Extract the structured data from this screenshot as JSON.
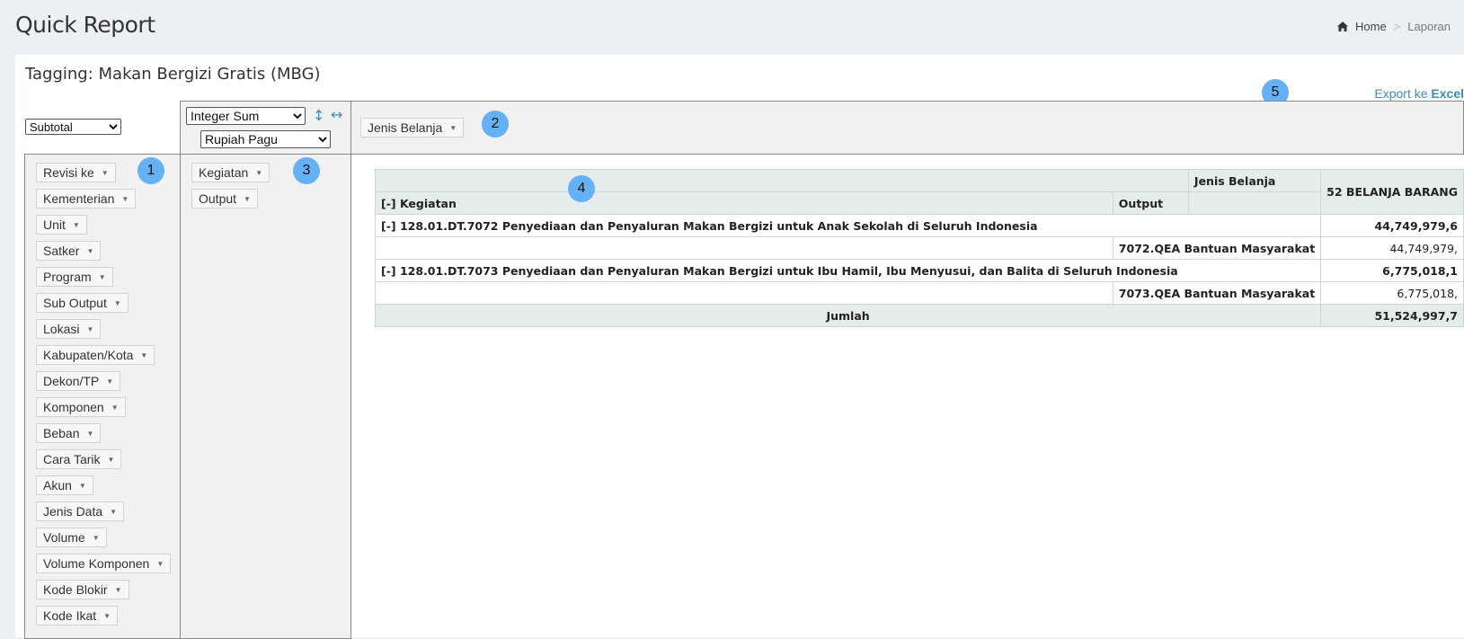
{
  "page": {
    "title": "Quick Report"
  },
  "breadcrumb": {
    "home": "Home",
    "separator": ">",
    "current": "Laporan"
  },
  "report": {
    "tag_title": "Tagging: Makan Bergizi Gratis (MBG)",
    "export_prefix": "Export ke ",
    "export_strong": "Excel"
  },
  "controls": {
    "renderer_selected": "Subtotal",
    "aggregator_selected": "Integer Sum",
    "value_field_selected": "Rupiah Pagu",
    "col_attr": "Jenis Belanja"
  },
  "badges": [
    "1",
    "2",
    "3",
    "4",
    "5"
  ],
  "unused_attrs": [
    "Revisi ke",
    "Kementerian",
    "Unit",
    "Satker",
    "Program",
    "Sub Output",
    "Lokasi",
    "Kabupaten/Kota",
    "Dekon/TP",
    "Komponen",
    "Beban",
    "Cara Tarik",
    "Akun",
    "Jenis Data",
    "Volume",
    "Volume Komponen",
    "Kode Blokir",
    "Kode Ikat"
  ],
  "row_attrs": [
    "Kegiatan",
    "Output"
  ],
  "pivot": {
    "col_header_label": "Jenis Belanja",
    "col_value": "52 BELANJA BARANG",
    "row_header_1": "[-] Kegiatan",
    "row_header_2": "Output",
    "rows": [
      {
        "kegiatan": "[-] 128.01.DT.7072 Penyediaan dan Penyaluran Makan Bergizi untuk Anak Sekolah di Seluruh Indonesia",
        "subtotal": "44,749,979,6",
        "output": "7072.QEA Bantuan Masyarakat",
        "value": "44,749,979,"
      },
      {
        "kegiatan": "[-] 128.01.DT.7073 Penyediaan dan Penyaluran Makan Bergizi untuk Ibu Hamil, Ibu Menyusui, dan Balita di Seluruh Indonesia",
        "subtotal": "6,775,018,1",
        "output": "7073.QEA Bantuan Masyarakat",
        "value": "6,775,018,"
      }
    ],
    "total_label": "Jumlah",
    "total_value": "51,524,997,7"
  }
}
